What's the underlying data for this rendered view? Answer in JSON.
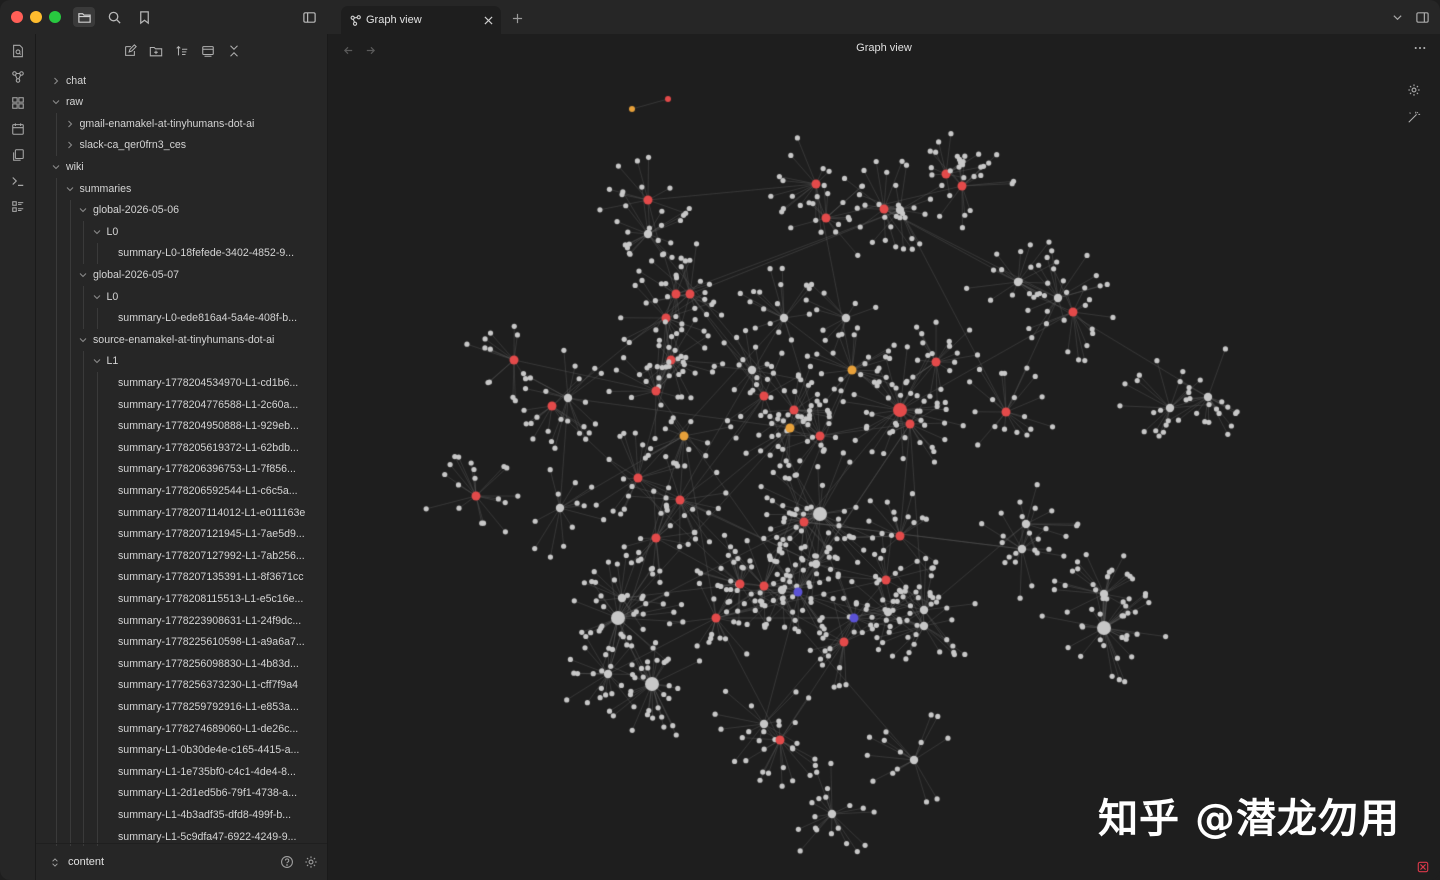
{
  "tab": {
    "title": "Graph view",
    "icon": "graph-icon"
  },
  "view": {
    "title": "Graph view"
  },
  "sidebar": {
    "tree": [
      {
        "label": "chat",
        "depth": 0,
        "expanded": false
      },
      {
        "label": "raw",
        "depth": 0,
        "expanded": true
      },
      {
        "label": "gmail-enamakel-at-tinyhumans-dot-ai",
        "depth": 1,
        "expanded": false
      },
      {
        "label": "slack-ca_qer0frn3_ces",
        "depth": 1,
        "expanded": false
      },
      {
        "label": "wiki",
        "depth": 0,
        "expanded": true
      },
      {
        "label": "summaries",
        "depth": 1,
        "expanded": true
      },
      {
        "label": "global-2026-05-06",
        "depth": 2,
        "expanded": true
      },
      {
        "label": "L0",
        "depth": 3,
        "expanded": true
      },
      {
        "label": "summary-L0-18fefede-3402-4852-9...",
        "depth": 4,
        "file": true
      },
      {
        "label": "global-2026-05-07",
        "depth": 2,
        "expanded": true
      },
      {
        "label": "L0",
        "depth": 3,
        "expanded": true
      },
      {
        "label": "summary-L0-ede816a4-5a4e-408f-b...",
        "depth": 4,
        "file": true
      },
      {
        "label": "source-enamakel-at-tinyhumans-dot-ai",
        "depth": 2,
        "expanded": true
      },
      {
        "label": "L1",
        "depth": 3,
        "expanded": true
      },
      {
        "label": "summary-1778204534970-L1-cd1b6...",
        "depth": 4,
        "file": true
      },
      {
        "label": "summary-1778204776588-L1-2c60a...",
        "depth": 4,
        "file": true
      },
      {
        "label": "summary-1778204950888-L1-929eb...",
        "depth": 4,
        "file": true
      },
      {
        "label": "summary-1778205619372-L1-62bdb...",
        "depth": 4,
        "file": true
      },
      {
        "label": "summary-1778206396753-L1-7f856...",
        "depth": 4,
        "file": true
      },
      {
        "label": "summary-1778206592544-L1-c6c5a...",
        "depth": 4,
        "file": true
      },
      {
        "label": "summary-1778207114012-L1-e011163e",
        "depth": 4,
        "file": true
      },
      {
        "label": "summary-1778207121945-L1-7ae5d9...",
        "depth": 4,
        "file": true
      },
      {
        "label": "summary-1778207127992-L1-7ab256...",
        "depth": 4,
        "file": true
      },
      {
        "label": "summary-1778207135391-L1-8f3671cc",
        "depth": 4,
        "file": true
      },
      {
        "label": "summary-1778208115513-L1-e5c16e...",
        "depth": 4,
        "file": true
      },
      {
        "label": "summary-1778223908631-L1-24f9dc...",
        "depth": 4,
        "file": true
      },
      {
        "label": "summary-1778225610598-L1-a9a6a7...",
        "depth": 4,
        "file": true
      },
      {
        "label": "summary-1778256098830-L1-4b83d...",
        "depth": 4,
        "file": true
      },
      {
        "label": "summary-1778256373230-L1-cff7f9a4",
        "depth": 4,
        "file": true
      },
      {
        "label": "summary-1778259792916-L1-e853a...",
        "depth": 4,
        "file": true
      },
      {
        "label": "summary-1778274689060-L1-de26c...",
        "depth": 4,
        "file": true
      },
      {
        "label": "summary-L1-0b30de4e-c165-4415-a...",
        "depth": 4,
        "file": true
      },
      {
        "label": "summary-L1-1e735bf0-c4c1-4de4-8...",
        "depth": 4,
        "file": true
      },
      {
        "label": "summary-L1-2d1ed5b6-79f1-4738-a...",
        "depth": 4,
        "file": true
      },
      {
        "label": "summary-L1-4b3adf35-dfd8-499f-b...",
        "depth": 4,
        "file": true
      },
      {
        "label": "summary-L1-5c9dfa47-6922-4249-9...",
        "depth": 4,
        "file": true
      }
    ],
    "vault_name": "content"
  },
  "colors": {
    "node_default": "#c8c8c8",
    "node_red": "#e34a4a",
    "node_orange": "#e8a13a",
    "node_blue": "#5b52d6",
    "edge": "#5a5a5a",
    "background": "#1e1e1e"
  },
  "watermark": "知乎 @潜龙勿用"
}
